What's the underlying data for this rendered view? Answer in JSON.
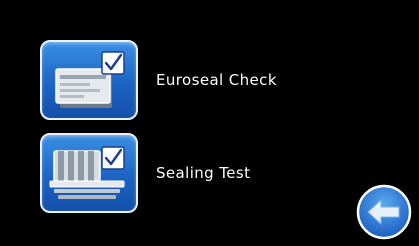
{
  "menu": {
    "items": [
      {
        "label": "Euroseal Check",
        "icon": "euroseal-check-icon"
      },
      {
        "label": "Sealing Test",
        "icon": "sealing-test-icon"
      }
    ]
  },
  "navigation": {
    "back_icon": "back-arrow-icon"
  },
  "colors": {
    "background": "#000000",
    "tile_blue": "#1d64c4",
    "tile_border": "#e8f0fb",
    "text": "#ffffff",
    "checkmark": "#1a3d8f"
  }
}
